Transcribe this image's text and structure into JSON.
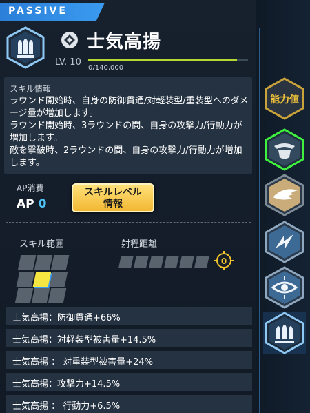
{
  "header": {
    "tag_label": "PASSIVE"
  },
  "skill": {
    "name": "士気高揚",
    "level": "LV. 10",
    "xp_text": "0/140,000",
    "xp_progress": 0.93
  },
  "info": {
    "heading": "スキル情報",
    "description": "ラウンド開始時、自身の防御貫通/対軽装型/重装型へのダメージ量が増加します。\nラウンド開始時、3ラウンドの間、自身の攻撃力/行動力が増加します。\n敵を撃破時、2ラウンドの間、自身の攻撃力/行動力が増加します。"
  },
  "ap": {
    "label": "AP消費",
    "prefix": "AP",
    "value": "0"
  },
  "skill_level_button": {
    "label": "スキルレベル情報"
  },
  "range": {
    "label": "スキル範囲"
  },
  "distance": {
    "label": "射程距離",
    "target_value": "0"
  },
  "effects": [
    "士気高揚：防御貫通+66%",
    "士気高揚：対軽装型被害量+14.5%",
    "士気高揚 ： 対重装型被害量+24%",
    "士気高揚：攻撃力+14.5%",
    "士気高揚 ： 行動力+6.5%"
  ],
  "sidebar": {
    "stats_label": "能力値",
    "items": [
      {
        "icon": "winged-shield-icon",
        "selected": true
      },
      {
        "icon": "wing-icon",
        "selected": false
      },
      {
        "icon": "lightning-icon",
        "selected": false
      },
      {
        "icon": "eye-target-icon",
        "selected": false
      },
      {
        "icon": "bullets-icon",
        "selected": false
      }
    ]
  },
  "colors": {
    "accent_blue": "#3a9bf0",
    "xp_green": "#b5d732",
    "button_gold": "#f2b733",
    "selected_green": "#3ff03f",
    "highlight_yellow": "#f5e642"
  }
}
